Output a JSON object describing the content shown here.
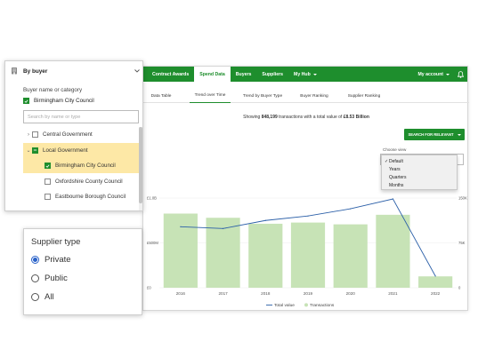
{
  "nav": {
    "items": [
      "Contract Awards",
      "Spend Data",
      "Buyers",
      "Suppliers",
      "My Hub"
    ],
    "active": "Spend Data",
    "account": "My account"
  },
  "subtabs": [
    "Data Table",
    "Trend over Time",
    "Trend by Buyer Type",
    "Buyer Ranking",
    "Supplier Ranking"
  ],
  "active_subtab": "Trend over Time",
  "summary": {
    "prefix": "Showing ",
    "transactions": "848,199",
    "middle": " transactions with a total value of ",
    "value": "£8.53 Billion"
  },
  "search_button": "SEARCH FOR RELEVANT",
  "view": {
    "label": "Choose view",
    "options": [
      "Default",
      "Years",
      "Quarters",
      "Months"
    ],
    "selected": "Default"
  },
  "chart_data": {
    "type": "bar",
    "categories": [
      "2016",
      "2017",
      "2018",
      "2019",
      "2020",
      "2021",
      "2022"
    ],
    "series": [
      {
        "name": "Transactions",
        "type": "bar",
        "axis": "right",
        "values": [
          124000,
          117000,
          107000,
          109000,
          106000,
          122000,
          19000
        ]
      },
      {
        "name": "Total value",
        "type": "line",
        "axis": "left",
        "values": [
          0.68,
          0.66,
          0.75,
          0.8,
          0.88,
          0.99,
          0.13
        ]
      }
    ],
    "yleft_ticks": [
      "£1.0B",
      "£500M",
      "£0"
    ],
    "yright_ticks": [
      "150K",
      "75K",
      "0"
    ],
    "yleft_range": [
      0,
      1.0
    ],
    "yright_range": [
      0,
      150000
    ],
    "colors": {
      "bar": "#c7e3b6",
      "line": "#2b5fa8"
    },
    "legend_position": "bottom"
  },
  "buyer_panel": {
    "title": "By buyer",
    "subtitle": "Buyer name or category",
    "selected": "Birmingham City Council",
    "search_placeholder": "Search by name or type",
    "tree": [
      {
        "label": "Central Government",
        "level": 0,
        "expander": "›",
        "state": "off",
        "highlight": false
      },
      {
        "label": "Local Government",
        "level": 0,
        "expander": "⌄",
        "state": "partial",
        "highlight": true
      },
      {
        "label": "Birmingham City Council",
        "level": 1,
        "expander": "",
        "state": "on",
        "highlight": true
      },
      {
        "label": "Oxfordshire County Council",
        "level": 1,
        "expander": "",
        "state": "off",
        "highlight": false
      },
      {
        "label": "Eastbourne Borough Council",
        "level": 1,
        "expander": "",
        "state": "off",
        "highlight": false
      }
    ]
  },
  "supplier_panel": {
    "title": "Supplier type",
    "options": [
      "Private",
      "Public",
      "All"
    ],
    "selected": "Private"
  }
}
